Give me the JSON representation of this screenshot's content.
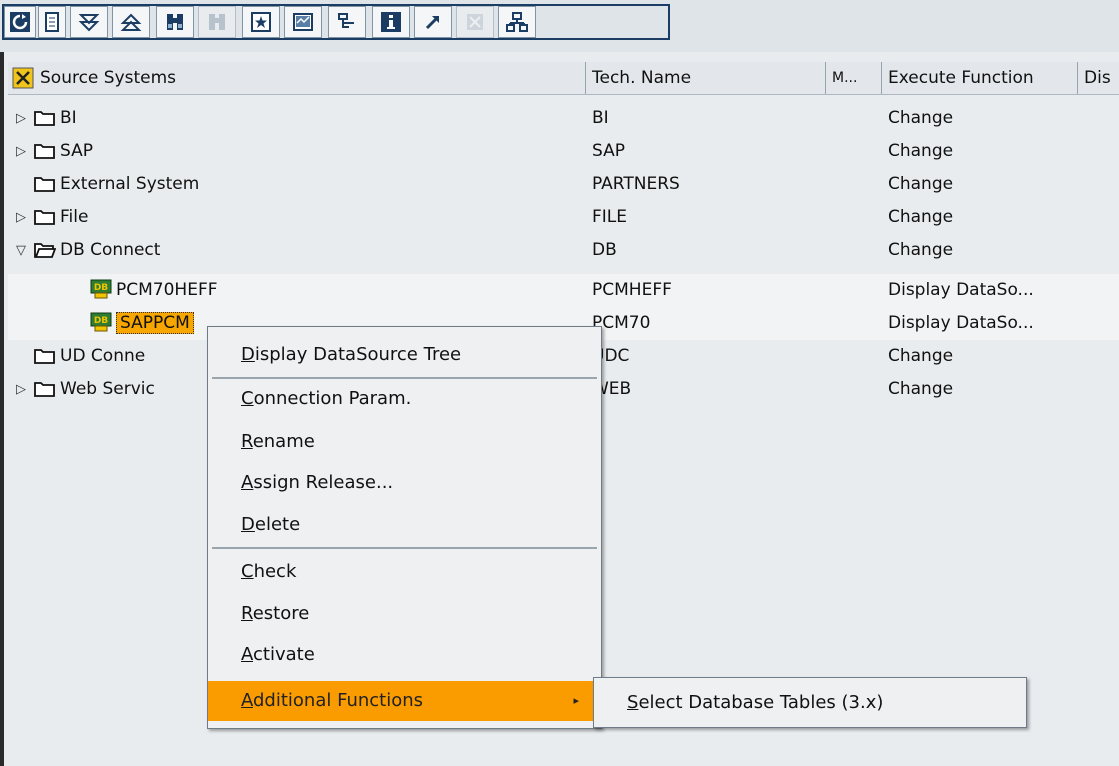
{
  "toolbar": {
    "buttons": [
      {
        "icon": "refresh-icon",
        "enabled": true
      },
      {
        "icon": "document-icon",
        "enabled": true
      },
      {
        "icon": "expand-all-icon",
        "enabled": true
      },
      {
        "icon": "collapse-all-icon",
        "enabled": true
      },
      {
        "icon": "find-icon",
        "enabled": true
      },
      {
        "icon": "find-next-icon",
        "enabled": false
      },
      {
        "icon": "create-icon",
        "enabled": true
      },
      {
        "icon": "chart-icon",
        "enabled": true
      },
      {
        "icon": "hierarchy-icon",
        "enabled": true
      },
      {
        "icon": "info-icon",
        "enabled": true
      },
      {
        "icon": "pointer-icon",
        "enabled": true
      },
      {
        "icon": "cancel-icon",
        "enabled": false
      },
      {
        "icon": "network-icon",
        "enabled": true
      }
    ]
  },
  "table": {
    "headers": {
      "source_systems": "Source Systems",
      "tech_name": "Tech. Name",
      "m": "M...",
      "execute_function": "Execute Function",
      "dis": "Dis"
    },
    "rows": [
      {
        "label": "BI",
        "tech_name": "BI",
        "execute": "Change",
        "expander": "▷",
        "icon": "folder-icon"
      },
      {
        "label": "SAP",
        "tech_name": "SAP",
        "execute": "Change",
        "expander": "▷",
        "icon": "folder-icon"
      },
      {
        "label": "External System",
        "tech_name": "PARTNERS",
        "execute": "Change",
        "expander": "",
        "icon": "folder-icon"
      },
      {
        "label": "File",
        "tech_name": "FILE",
        "execute": "Change",
        "expander": "▷",
        "icon": "folder-icon"
      },
      {
        "label": "DB Connect",
        "tech_name": "DB",
        "execute": "Change",
        "expander": "▽",
        "icon": "open-folder-icon"
      },
      {
        "label": "PCM70HEFF",
        "tech_name": "PCMHEFF",
        "execute": "Display DataSo...",
        "expander": "",
        "icon": "db-icon"
      },
      {
        "label": "SAPPCM",
        "tech_name": "PCM70",
        "execute": "Display DataSo...",
        "expander": "",
        "icon": "db-icon"
      },
      {
        "label": "UD Conne",
        "tech_name": "UDC",
        "execute": "Change",
        "expander": "",
        "icon": "folder-icon"
      },
      {
        "label": "Web Servic",
        "tech_name": "WEB",
        "execute": "Change",
        "expander": "▷",
        "icon": "folder-icon"
      }
    ]
  },
  "context_menu": {
    "items": [
      {
        "pre": "",
        "mn": "D",
        "post": "isplay DataSource Tree"
      },
      {
        "pre": "",
        "mn": "C",
        "post": "onnection Param."
      },
      {
        "pre": "",
        "mn": "R",
        "post": "ename"
      },
      {
        "pre": "",
        "mn": "A",
        "post": "ssign Release..."
      },
      {
        "pre": "",
        "mn": "D",
        "post": "elete"
      },
      {
        "pre": "",
        "mn": "C",
        "post": "heck"
      },
      {
        "pre": "",
        "mn": "R",
        "post": "estore"
      },
      {
        "pre": "",
        "mn": "A",
        "post": "ctivate"
      },
      {
        "pre": "",
        "mn": "A",
        "post": "dditional Functions"
      }
    ],
    "submenu_arrow": "▸",
    "submenu": {
      "pre": "",
      "mn": "S",
      "post": "elect Database Tables (3.x)"
    }
  },
  "colors": {
    "selection": "#f7a600",
    "menu_active": "#fa9b00",
    "background": "#e9ecef"
  }
}
